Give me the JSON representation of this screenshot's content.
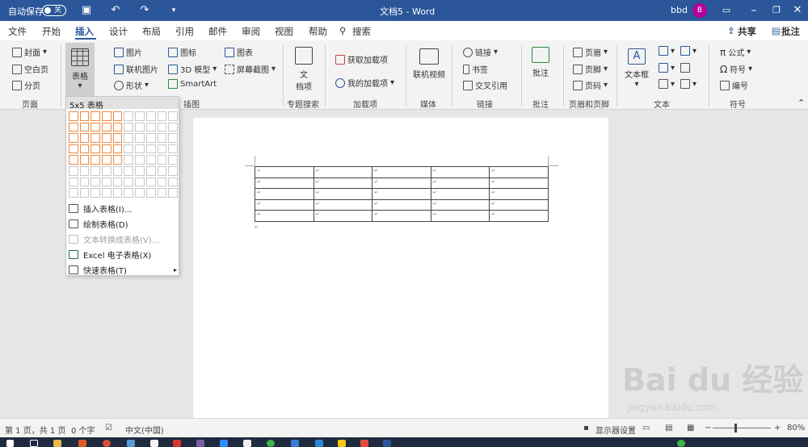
{
  "titlebar": {
    "autosave_label": "自动保存",
    "autosave_state": "关",
    "doc_title": "文档5  -  Word",
    "user_name": "bbd",
    "avatar_letter": "B",
    "icons": {
      "save": "save-icon",
      "undo": "undo-icon",
      "redo": "redo-icon",
      "customize": "customize-icon",
      "display": "ribbon-display-icon",
      "restore": "restore-icon",
      "close": "close-icon"
    }
  },
  "menu": {
    "tabs": [
      "文件",
      "开始",
      "插入",
      "设计",
      "布局",
      "引用",
      "邮件",
      "审阅",
      "视图",
      "帮助"
    ],
    "active": "插入",
    "search": "搜索",
    "share": "共享",
    "comments": "批注"
  },
  "ribbon": {
    "pages": {
      "cover": "封面",
      "blank": "空白页",
      "break": "分页",
      "group": "页面"
    },
    "table": {
      "label": "表格"
    },
    "illustrations": {
      "pictures": "图片",
      "online_pictures": "联机图片",
      "shapes": "形状",
      "icons": "图标",
      "models": "3D 模型",
      "smartart": "SmartArt",
      "chart": "图表",
      "screenshot": "屏幕截图",
      "group": "插图"
    },
    "topic": {
      "label": "文档项",
      "label_top": "文",
      "label_bottom": "档项",
      "group": "专题搜索"
    },
    "addins": {
      "get": "获取加载项",
      "my": "我的加载项",
      "group": "加载项"
    },
    "media": {
      "video": "联机视频",
      "group": "媒体"
    },
    "links": {
      "link": "链接",
      "bookmark": "书签",
      "crossref": "交叉引用",
      "group": "链接"
    },
    "comments": {
      "comment": "批注",
      "group": "批注"
    },
    "headerfooter": {
      "header": "页眉",
      "footer": "页脚",
      "pagenum": "页码",
      "group": "页眉和页脚"
    },
    "text": {
      "textbox": "文本框",
      "group": "文本"
    },
    "symbols": {
      "equation": "公式",
      "symbol": "符号",
      "number": "编号",
      "group": "符号"
    }
  },
  "dropdown": {
    "header": "5x5 表格",
    "grid_cols": 10,
    "grid_rows": 8,
    "selected_cols": 5,
    "selected_rows": 5,
    "items": [
      {
        "label": "插入表格(I)...",
        "enabled": true
      },
      {
        "label": "绘制表格(D)",
        "enabled": true
      },
      {
        "label": "文本转换成表格(V)...",
        "enabled": false
      },
      {
        "label": "Excel 电子表格(X)",
        "enabled": true
      },
      {
        "label": "快速表格(T)",
        "enabled": true
      }
    ]
  },
  "document": {
    "rows": 5,
    "cols": 5,
    "cell_mark": "↵"
  },
  "status": {
    "page": "第 1 页，共 1 页",
    "words": "0 个字",
    "lang": "中文(中国)",
    "display": "显示器设置",
    "zoom": "80%"
  },
  "watermark": {
    "main": "Bai du 经验",
    "sub": "jingyan.baidu.com"
  }
}
